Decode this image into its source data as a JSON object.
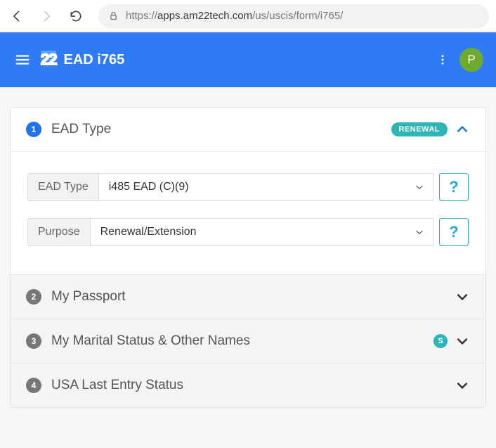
{
  "browser": {
    "url_scheme": "https://",
    "url_host": "apps.am22tech.com",
    "url_path": "/us/uscis/form/i765/"
  },
  "header": {
    "logo_text": "22",
    "title": "EAD i765",
    "avatar_initial": "P"
  },
  "sections": [
    {
      "num": "1",
      "title": "EAD Type",
      "badge": "RENEWAL",
      "fields": {
        "ead_type": {
          "label": "EAD Type",
          "value": "i485 EAD (C)(9)"
        },
        "purpose": {
          "label": "Purpose",
          "value": "Renewal/Extension"
        }
      }
    },
    {
      "num": "2",
      "title": "My Passport"
    },
    {
      "num": "3",
      "title": "My Marital Status & Other Names",
      "mini_badge": "S"
    },
    {
      "num": "4",
      "title": "USA Last Entry Status"
    }
  ],
  "glyphs": {
    "help": "?"
  }
}
